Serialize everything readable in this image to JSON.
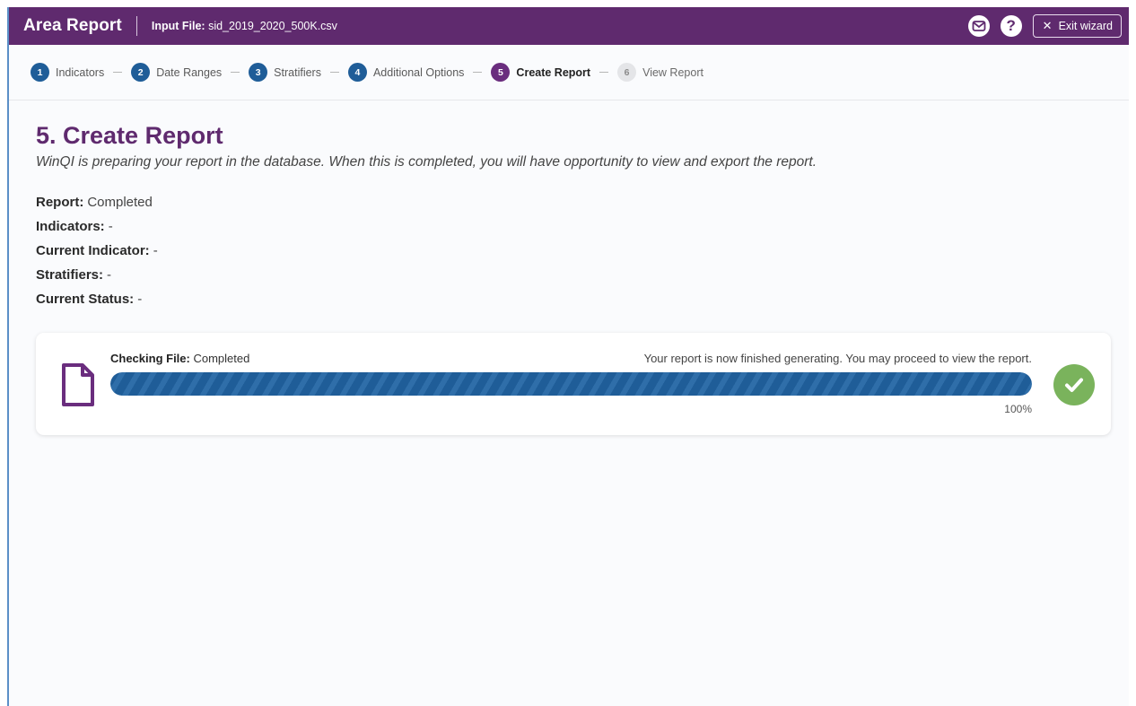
{
  "header": {
    "app_title": "Area Report",
    "input_file_label": "Input File:",
    "input_file_value": "sid_2019_2020_500K.csv",
    "mail_icon": "mail-icon",
    "help_icon": "help-icon",
    "help_glyph": "?",
    "exit_icon": "close-icon",
    "exit_label": "Exit wizard"
  },
  "steps": [
    {
      "num": "1",
      "label": "Indicators",
      "state": "done"
    },
    {
      "num": "2",
      "label": "Date Ranges",
      "state": "done"
    },
    {
      "num": "3",
      "label": "Stratifiers",
      "state": "done"
    },
    {
      "num": "4",
      "label": "Additional Options",
      "state": "done"
    },
    {
      "num": "5",
      "label": "Create Report",
      "state": "active"
    },
    {
      "num": "6",
      "label": "View Report",
      "state": "pending"
    }
  ],
  "main": {
    "title": "5. Create Report",
    "subtitle": "WinQI is preparing your report in the database. When this is completed, you will have opportunity to view and export the report.",
    "info": [
      {
        "key": "Report:",
        "value": "Completed"
      },
      {
        "key": "Indicators:",
        "value": "-"
      },
      {
        "key": "Current Indicator:",
        "value": "-"
      },
      {
        "key": "Stratifiers:",
        "value": "-"
      },
      {
        "key": "Current Status:",
        "value": "-"
      }
    ]
  },
  "progress": {
    "label": "Checking File:",
    "status": "Completed",
    "message": "Your report is now finished generating. You may proceed to view the report.",
    "percent_text": "100%",
    "percent": 100,
    "file_icon": "file-icon",
    "done_icon": "check-circle-icon"
  },
  "colors": {
    "brand": "#5f2a6e",
    "step_done": "#1f5d98",
    "progress": "#1f5d98",
    "success": "#7ab35c"
  }
}
